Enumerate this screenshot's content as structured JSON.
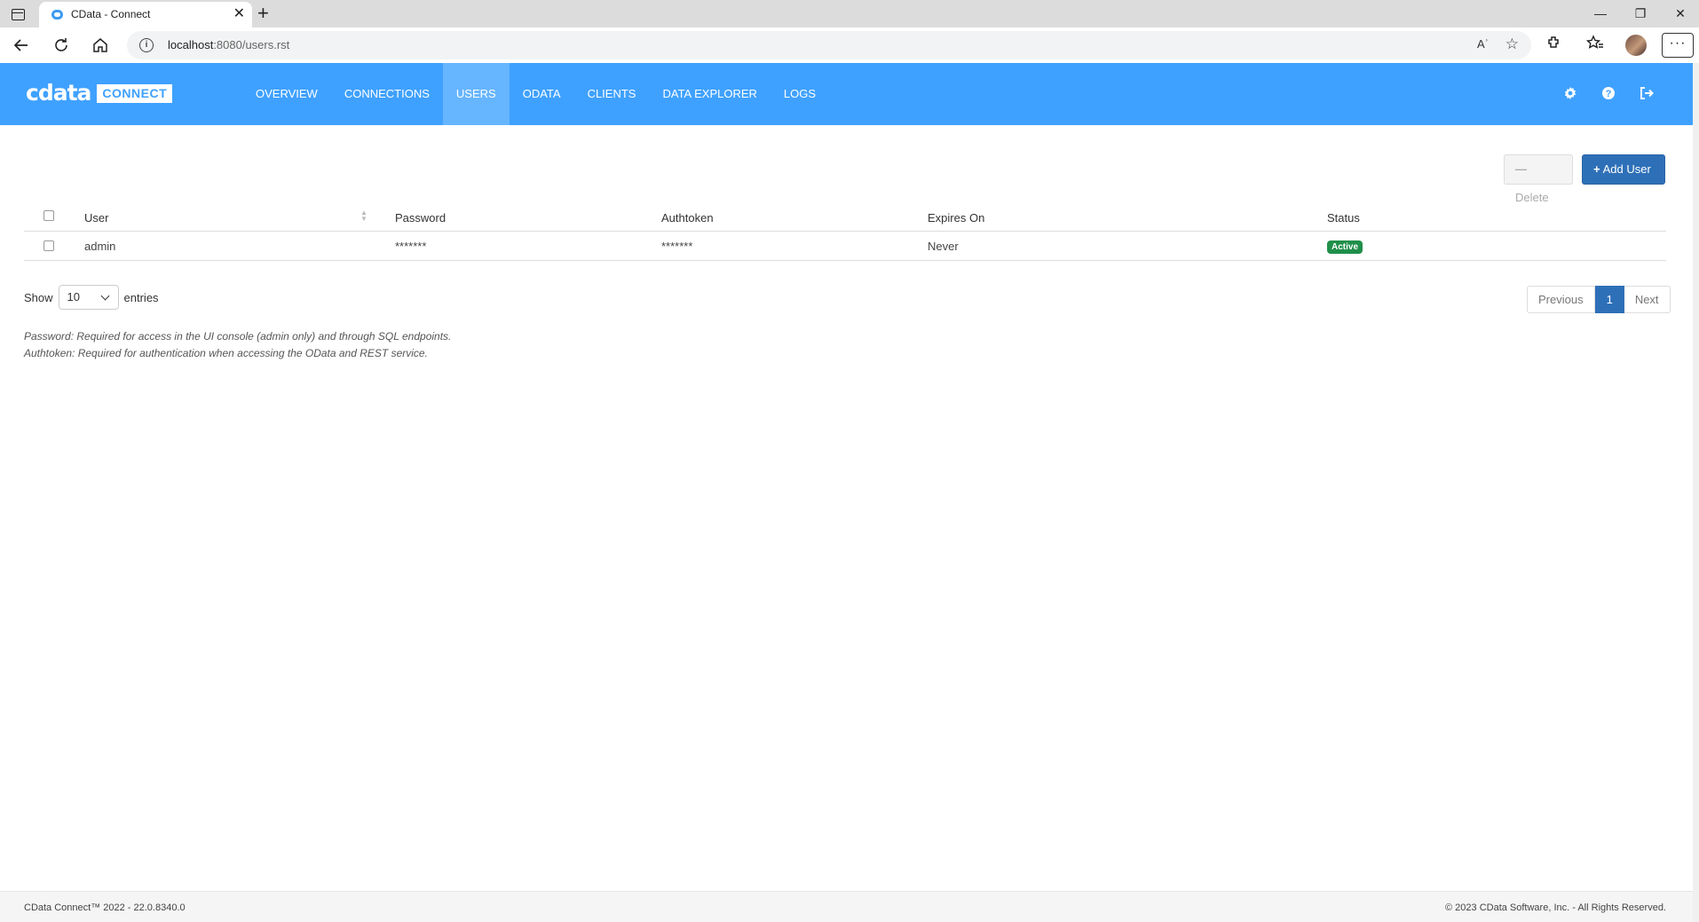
{
  "browser": {
    "tab_title": "CData - Connect",
    "tab_close": "✕",
    "new_tab": "+",
    "url_host": "localhost",
    "url_rest": ":8080/users.rst",
    "read_aloud": "Aʾ",
    "favorite": "☆",
    "more": "···",
    "minimize": "—",
    "restore": "❐",
    "close": "✕"
  },
  "header": {
    "logo_cdata": "cdata",
    "logo_connect": "CONNECT",
    "nav": [
      {
        "label": "OVERVIEW"
      },
      {
        "label": "CONNECTIONS"
      },
      {
        "label": "USERS"
      },
      {
        "label": "ODATA"
      },
      {
        "label": "CLIENTS"
      },
      {
        "label": "DATA EXPLORER"
      },
      {
        "label": "LOGS"
      }
    ],
    "active_nav": "USERS"
  },
  "actions": {
    "delete_label": "Delete",
    "delete_symbol": "—",
    "add_label": "Add User",
    "add_symbol": "+"
  },
  "table": {
    "columns": [
      "User",
      "Password",
      "Authtoken",
      "Expires On",
      "Status"
    ],
    "rows": [
      {
        "user": "admin",
        "password": "*******",
        "authtoken": "*******",
        "expires_on": "Never",
        "status": "Active"
      }
    ]
  },
  "length": {
    "show_label": "Show",
    "value": "10",
    "entries_label": "entries"
  },
  "pagination": {
    "previous": "Previous",
    "current": "1",
    "next": "Next"
  },
  "notes": {
    "password": "Password: Required for access in the UI console (admin only) and through SQL endpoints.",
    "authtoken": "Authtoken: Required for authentication when accessing the OData and REST service."
  },
  "footer": {
    "left": "CData Connect™ 2022 - 22.0.8340.0",
    "right": "© 2023 CData Software, Inc. - All Rights Reserved."
  },
  "colors": {
    "header_blue": "#3fa1ff",
    "active_nav": "#66b5ff",
    "primary_button": "#2e70b8",
    "status_active": "#1f8f4a"
  }
}
